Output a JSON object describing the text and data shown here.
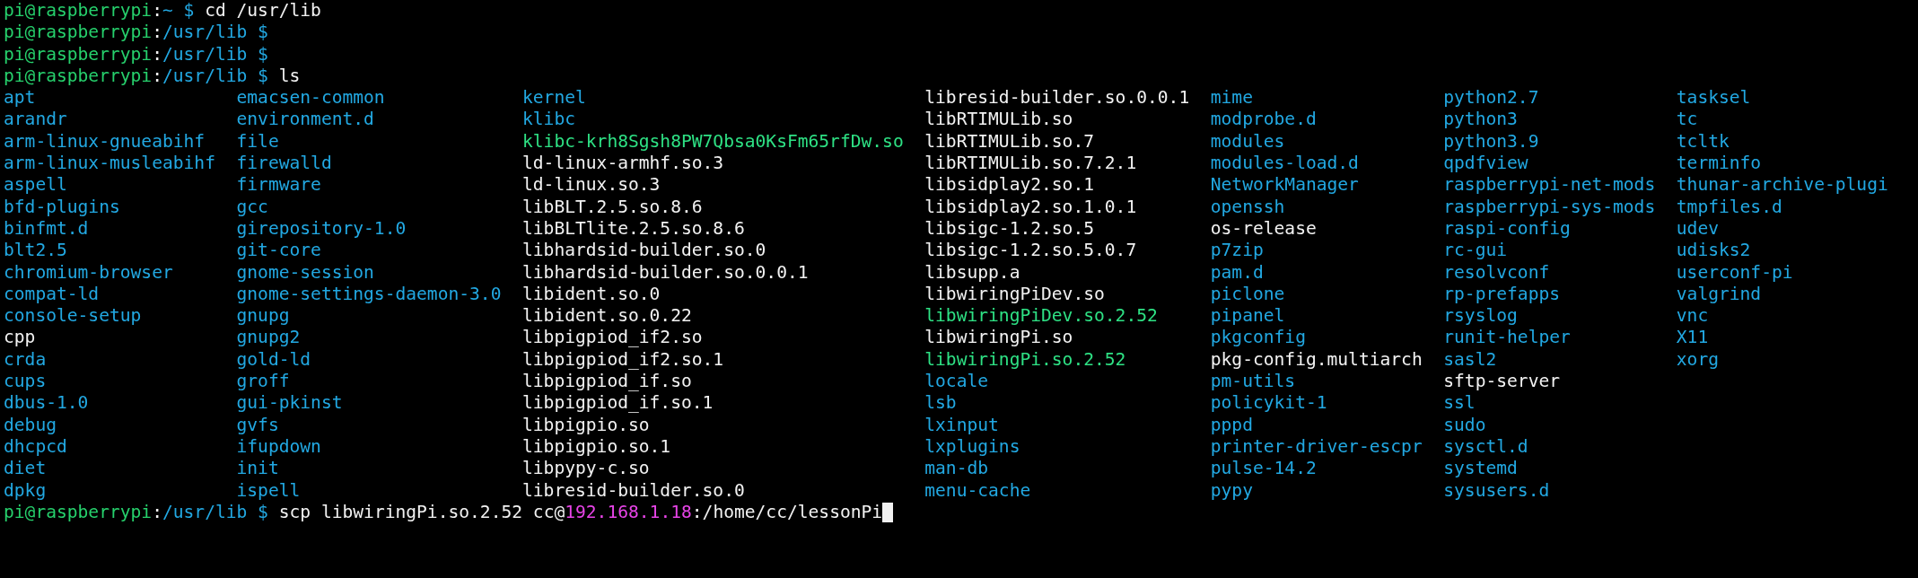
{
  "prompts": [
    {
      "user": "pi@raspberrypi",
      "separator": ":",
      "path": "~",
      "symbol": "$",
      "command": "cd /usr/lib"
    },
    {
      "user": "pi@raspberrypi",
      "separator": ":",
      "path": "/usr/lib",
      "symbol": "$"
    },
    {
      "user": "pi@raspberrypi",
      "separator": ":",
      "path": "/usr/lib",
      "symbol": "$"
    },
    {
      "user": "pi@raspberrypi",
      "separator": ":",
      "path": "/usr/lib",
      "symbol": "$",
      "command": "ls"
    }
  ],
  "listing": {
    "columns": [
      [
        {
          "name": "apt",
          "kind": "dir"
        },
        {
          "name": "arandr",
          "kind": "dir"
        },
        {
          "name": "arm-linux-gnueabihf",
          "kind": "dir"
        },
        {
          "name": "arm-linux-musleabihf",
          "kind": "dir"
        },
        {
          "name": "aspell",
          "kind": "dir"
        },
        {
          "name": "bfd-plugins",
          "kind": "dir"
        },
        {
          "name": "binfmt.d",
          "kind": "dir"
        },
        {
          "name": "blt2.5",
          "kind": "dir"
        },
        {
          "name": "chromium-browser",
          "kind": "dir"
        },
        {
          "name": "compat-ld",
          "kind": "dir"
        },
        {
          "name": "console-setup",
          "kind": "dir"
        },
        {
          "name": "cpp",
          "kind": "file"
        },
        {
          "name": "crda",
          "kind": "dir"
        },
        {
          "name": "cups",
          "kind": "dir"
        },
        {
          "name": "dbus-1.0",
          "kind": "dir"
        },
        {
          "name": "debug",
          "kind": "dir"
        },
        {
          "name": "dhcpcd",
          "kind": "dir"
        },
        {
          "name": "diet",
          "kind": "dir"
        },
        {
          "name": "dpkg",
          "kind": "dir"
        }
      ],
      [
        {
          "name": "emacsen-common",
          "kind": "dir"
        },
        {
          "name": "environment.d",
          "kind": "dir"
        },
        {
          "name": "file",
          "kind": "dir"
        },
        {
          "name": "firewalld",
          "kind": "dir"
        },
        {
          "name": "firmware",
          "kind": "dir"
        },
        {
          "name": "gcc",
          "kind": "dir"
        },
        {
          "name": "girepository-1.0",
          "kind": "dir"
        },
        {
          "name": "git-core",
          "kind": "dir"
        },
        {
          "name": "gnome-session",
          "kind": "dir"
        },
        {
          "name": "gnome-settings-daemon-3.0",
          "kind": "dir"
        },
        {
          "name": "gnupg",
          "kind": "dir"
        },
        {
          "name": "gnupg2",
          "kind": "dir"
        },
        {
          "name": "gold-ld",
          "kind": "dir"
        },
        {
          "name": "groff",
          "kind": "dir"
        },
        {
          "name": "gui-pkinst",
          "kind": "dir"
        },
        {
          "name": "gvfs",
          "kind": "dir"
        },
        {
          "name": "ifupdown",
          "kind": "dir"
        },
        {
          "name": "init",
          "kind": "dir"
        },
        {
          "name": "ispell",
          "kind": "dir"
        }
      ],
      [
        {
          "name": "kernel",
          "kind": "dir"
        },
        {
          "name": "klibc",
          "kind": "dir"
        },
        {
          "name": "klibc-krh8Sgsh8PW7Qbsa0KsFm65rfDw.so",
          "kind": "exec"
        },
        {
          "name": "ld-linux-armhf.so.3",
          "kind": "file"
        },
        {
          "name": "ld-linux.so.3",
          "kind": "file"
        },
        {
          "name": "libBLT.2.5.so.8.6",
          "kind": "file"
        },
        {
          "name": "libBLTlite.2.5.so.8.6",
          "kind": "file"
        },
        {
          "name": "libhardsid-builder.so.0",
          "kind": "file"
        },
        {
          "name": "libhardsid-builder.so.0.0.1",
          "kind": "file"
        },
        {
          "name": "libident.so.0",
          "kind": "file"
        },
        {
          "name": "libident.so.0.22",
          "kind": "file"
        },
        {
          "name": "libpigpiod_if2.so",
          "kind": "file"
        },
        {
          "name": "libpigpiod_if2.so.1",
          "kind": "file"
        },
        {
          "name": "libpigpiod_if.so",
          "kind": "file"
        },
        {
          "name": "libpigpiod_if.so.1",
          "kind": "file"
        },
        {
          "name": "libpigpio.so",
          "kind": "file"
        },
        {
          "name": "libpigpio.so.1",
          "kind": "file"
        },
        {
          "name": "libpypy-c.so",
          "kind": "file"
        },
        {
          "name": "libresid-builder.so.0",
          "kind": "file"
        }
      ],
      [
        {
          "name": "libresid-builder.so.0.0.1",
          "kind": "file"
        },
        {
          "name": "libRTIMULib.so",
          "kind": "file"
        },
        {
          "name": "libRTIMULib.so.7",
          "kind": "file"
        },
        {
          "name": "libRTIMULib.so.7.2.1",
          "kind": "file"
        },
        {
          "name": "libsidplay2.so.1",
          "kind": "file"
        },
        {
          "name": "libsidplay2.so.1.0.1",
          "kind": "file"
        },
        {
          "name": "libsigc-1.2.so.5",
          "kind": "file"
        },
        {
          "name": "libsigc-1.2.so.5.0.7",
          "kind": "file"
        },
        {
          "name": "libsupp.a",
          "kind": "file"
        },
        {
          "name": "libwiringPiDev.so",
          "kind": "file"
        },
        {
          "name": "libwiringPiDev.so.2.52",
          "kind": "exec"
        },
        {
          "name": "libwiringPi.so",
          "kind": "file"
        },
        {
          "name": "libwiringPi.so.2.52",
          "kind": "exec"
        },
        {
          "name": "locale",
          "kind": "dir"
        },
        {
          "name": "lsb",
          "kind": "dir"
        },
        {
          "name": "lxinput",
          "kind": "dir"
        },
        {
          "name": "lxplugins",
          "kind": "dir"
        },
        {
          "name": "man-db",
          "kind": "dir"
        },
        {
          "name": "menu-cache",
          "kind": "dir"
        }
      ],
      [
        {
          "name": "mime",
          "kind": "dir"
        },
        {
          "name": "modprobe.d",
          "kind": "dir"
        },
        {
          "name": "modules",
          "kind": "dir"
        },
        {
          "name": "modules-load.d",
          "kind": "dir"
        },
        {
          "name": "NetworkManager",
          "kind": "dir"
        },
        {
          "name": "openssh",
          "kind": "dir"
        },
        {
          "name": "os-release",
          "kind": "file"
        },
        {
          "name": "p7zip",
          "kind": "dir"
        },
        {
          "name": "pam.d",
          "kind": "dir"
        },
        {
          "name": "piclone",
          "kind": "dir"
        },
        {
          "name": "pipanel",
          "kind": "dir"
        },
        {
          "name": "pkgconfig",
          "kind": "dir"
        },
        {
          "name": "pkg-config.multiarch",
          "kind": "file"
        },
        {
          "name": "pm-utils",
          "kind": "dir"
        },
        {
          "name": "policykit-1",
          "kind": "dir"
        },
        {
          "name": "pppd",
          "kind": "dir"
        },
        {
          "name": "printer-driver-escpr",
          "kind": "dir"
        },
        {
          "name": "pulse-14.2",
          "kind": "dir"
        },
        {
          "name": "pypy",
          "kind": "dir"
        }
      ],
      [
        {
          "name": "python2.7",
          "kind": "dir"
        },
        {
          "name": "python3",
          "kind": "dir"
        },
        {
          "name": "python3.9",
          "kind": "dir"
        },
        {
          "name": "qpdfview",
          "kind": "dir"
        },
        {
          "name": "raspberrypi-net-mods",
          "kind": "dir"
        },
        {
          "name": "raspberrypi-sys-mods",
          "kind": "dir"
        },
        {
          "name": "raspi-config",
          "kind": "dir"
        },
        {
          "name": "rc-gui",
          "kind": "dir"
        },
        {
          "name": "resolvconf",
          "kind": "dir"
        },
        {
          "name": "rp-prefapps",
          "kind": "dir"
        },
        {
          "name": "rsyslog",
          "kind": "dir"
        },
        {
          "name": "runit-helper",
          "kind": "dir"
        },
        {
          "name": "sasl2",
          "kind": "dir"
        },
        {
          "name": "sftp-server",
          "kind": "file"
        },
        {
          "name": "ssl",
          "kind": "dir"
        },
        {
          "name": "sudo",
          "kind": "dir"
        },
        {
          "name": "sysctl.d",
          "kind": "dir"
        },
        {
          "name": "systemd",
          "kind": "dir"
        },
        {
          "name": "sysusers.d",
          "kind": "dir"
        }
      ],
      [
        {
          "name": "tasksel",
          "kind": "dir"
        },
        {
          "name": "tc",
          "kind": "dir"
        },
        {
          "name": "tcltk",
          "kind": "dir"
        },
        {
          "name": "terminfo",
          "kind": "dir"
        },
        {
          "name": "thunar-archive-plugi",
          "kind": "dir"
        },
        {
          "name": "tmpfiles.d",
          "kind": "dir"
        },
        {
          "name": "udev",
          "kind": "dir"
        },
        {
          "name": "udisks2",
          "kind": "dir"
        },
        {
          "name": "userconf-pi",
          "kind": "dir"
        },
        {
          "name": "valgrind",
          "kind": "dir"
        },
        {
          "name": "vnc",
          "kind": "dir"
        },
        {
          "name": "X11",
          "kind": "dir"
        },
        {
          "name": "xorg",
          "kind": "dir"
        }
      ]
    ]
  },
  "final_prompt": {
    "user": "pi@raspberrypi",
    "separator": ":",
    "path": "/usr/lib",
    "symbol": "$",
    "command_parts": [
      {
        "text": "scp libwiringPi.so.2.52 cc@",
        "kind": "plain"
      },
      {
        "text": "192.168.1.18",
        "kind": "address"
      },
      {
        "text": ":/home/cc/lessonPi",
        "kind": "plain"
      }
    ],
    "cursor": true
  }
}
